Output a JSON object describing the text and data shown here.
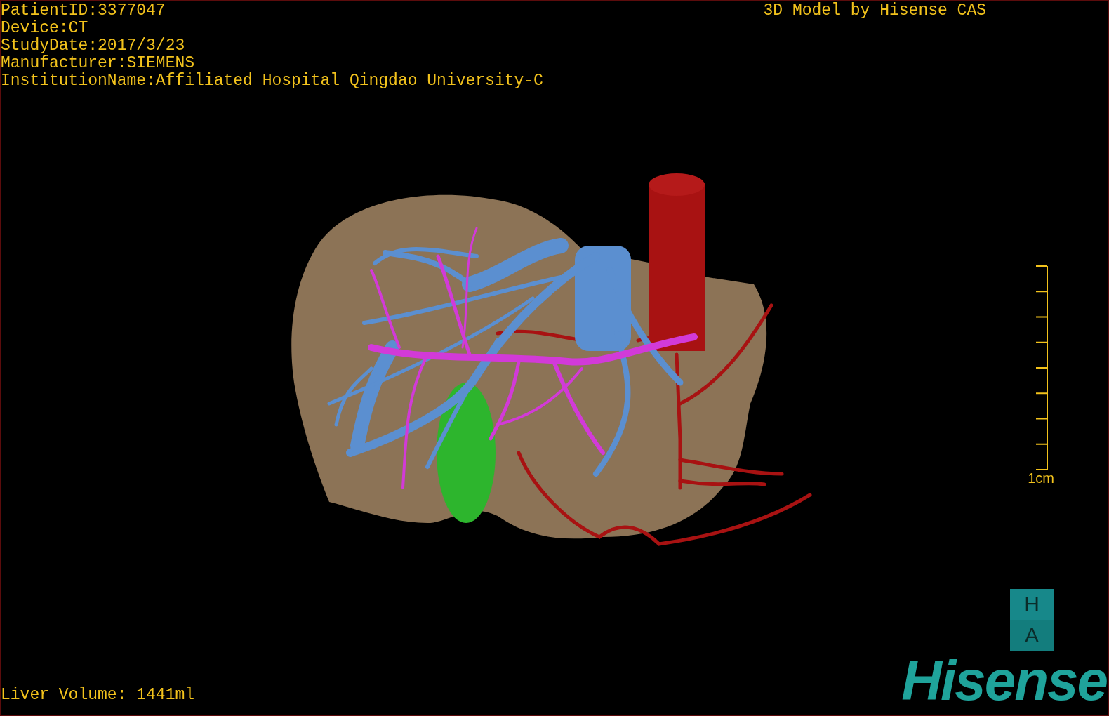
{
  "study_info": [
    "PatientID:3377047",
    "Device:CT",
    "StudyDate:2017/3/23",
    "Manufacturer:SIEMENS",
    "InstitutionName:Affiliated Hospital Qingdao University-C"
  ],
  "viewer_title": "3D Model by Hisense CAS",
  "scale_bar": {
    "label": "1cm"
  },
  "liver_volume": "Liver Volume: 1441ml",
  "logo": {
    "badge_top": "H",
    "badge_bottom": "A",
    "wordmark": "Hisense"
  }
}
